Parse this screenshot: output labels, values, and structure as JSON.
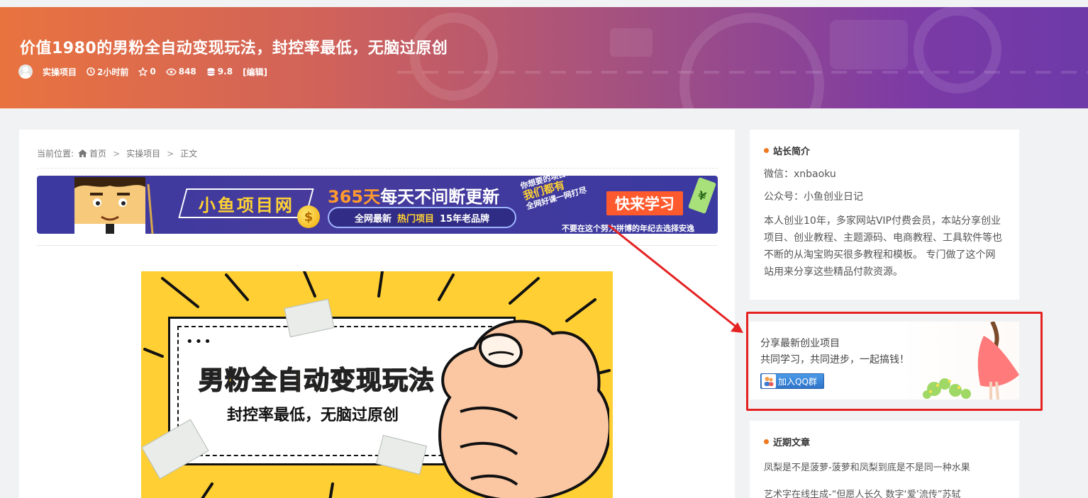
{
  "header": {
    "title": "价值1980的男粉全自动变现玩法，封控率最低，无脑过原创",
    "category": "实操项目",
    "time": "2小时前",
    "stars": "0",
    "views": "848",
    "score": "9.8",
    "edit": "[编辑]"
  },
  "breadcrumb": {
    "prefix": "当前位置:",
    "home": "首页",
    "category": "实操项目",
    "current": "正文",
    "sep": ">"
  },
  "banner": {
    "brand": "小鱼项目网",
    "headline_orange": "365天",
    "headline_white": "每天不间断更新",
    "pill_1": "全网最新",
    "pill_2": "热门项目",
    "pill_3": "15年老品牌",
    "slant_1": "你想要的项目课程",
    "slant_2": "我们都有",
    "slant_3": "全网好课一网打尽",
    "cta": "快来学习",
    "footer": "不要在这个努力拼博的年纪去选择安逸",
    "coin": "$",
    "money": "¥"
  },
  "article_image": {
    "title": "男粉全自动变现玩法",
    "subtitle": "封控率最低，无脑过原创",
    "dots": "•••"
  },
  "sidebar": {
    "intro": {
      "title": "站长简介",
      "wechat": "微信：xnbaoku",
      "official": "公众号：小鱼创业日记",
      "description": "本人创业10年，多家网站VIP付费会员，本站分享创业项目、创业教程、主题源码、电商教程、工具软件等也不断的从淘宝购买很多教程和模板。 专门做了这个网站用来分享这些精品付款资源。"
    },
    "qq": {
      "line1": "分享最新创业项目",
      "line2": "共同学习，共同进步，一起搞钱！",
      "button": "加入QQ群"
    },
    "recent": {
      "title": "近期文章",
      "items": [
        "凤梨是不是菠萝-菠萝和凤梨到底是不是同一种水果",
        "艺术字在线生成-“但愿人长久 数字‘爱’流传”苏轼"
      ]
    }
  },
  "colors": {
    "accent": "#f0781e",
    "annotation": "#e52222",
    "header_gradient_start": "#e9733f",
    "header_gradient_end": "#6d3aa8"
  }
}
